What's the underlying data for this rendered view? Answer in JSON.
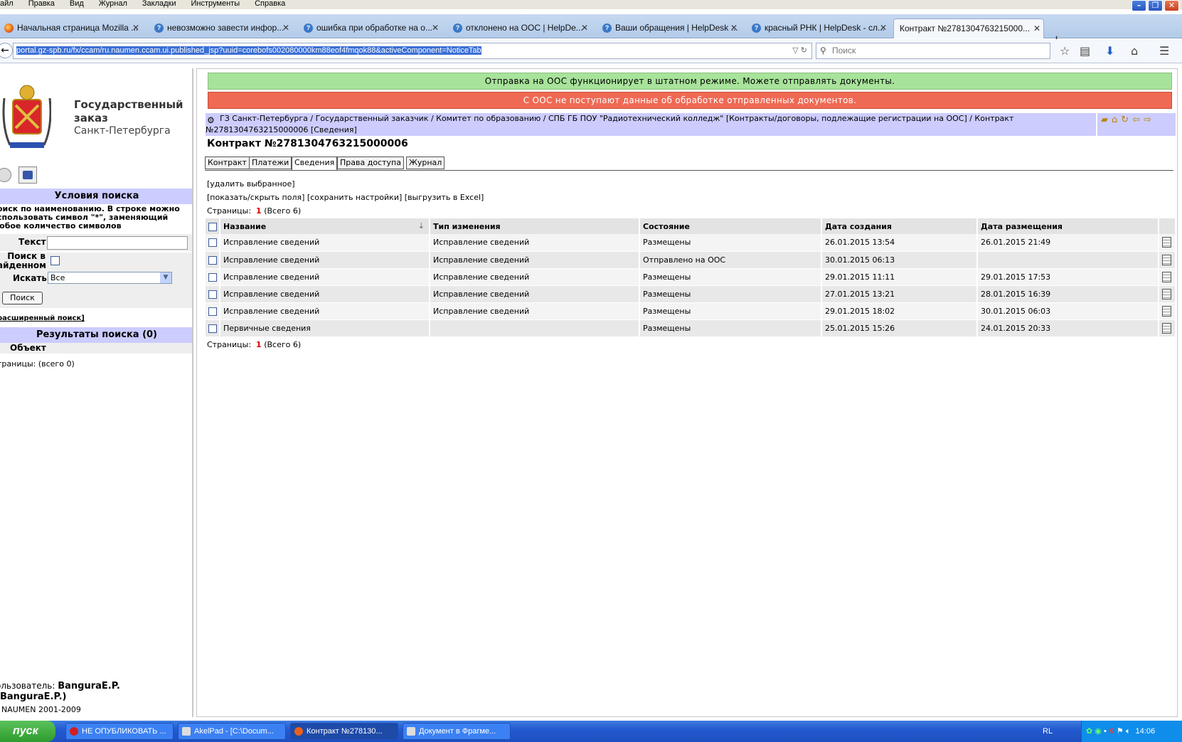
{
  "menubar": [
    "айл",
    "Правка",
    "Вид",
    "Журнал",
    "Закладки",
    "Инструменты",
    "Справка"
  ],
  "browser_tabs": [
    {
      "label": "Начальная страница Mozilla ...",
      "icon": "firefox-icon"
    },
    {
      "label": "невозможно завести инфор...",
      "icon": "help-icon"
    },
    {
      "label": "ошибка при обработке на о...",
      "icon": "help-icon"
    },
    {
      "label": "отклонено на ООС | HelpDe...",
      "icon": "help-icon"
    },
    {
      "label": "Ваши обращения | HelpDesk ...",
      "icon": "help-icon"
    },
    {
      "label": "красный РНК | HelpDesk - сл...",
      "icon": "help-icon"
    },
    {
      "label": "Контракт №2781304763215000...",
      "icon": "none"
    }
  ],
  "address": {
    "url": "portal.gz-spb.ru/fx/ccam/ru.naumen.ccam.ui.published_jsp?uuid=corebofs002080000km88eof4fmqok88&activeComponent=NoticeTab"
  },
  "browser_search": {
    "placeholder": "Поиск"
  },
  "org": {
    "title_line1": "Государственный",
    "title_line2": "заказ",
    "city": "Санкт-Петербурга"
  },
  "search_panel": {
    "header": "Условия поиска",
    "hint_line1": "оиск по наименованию. В строке можно",
    "hint_line2": "спользовать символ \"*\", заменяющий",
    "hint_line3": "юбое количество символов",
    "text_label": "Текст",
    "text_value": "",
    "found_label_1": "Поиск в",
    "found_label_2": "айденном",
    "search_in_label": "Искать",
    "search_in_value": "Все",
    "button": "Поиск",
    "advanced": "расширенный поиск]"
  },
  "results": {
    "header": "Результаты поиска (0)",
    "column": "Объект",
    "pages": "траницы:  (всего 0)"
  },
  "user": {
    "prefix": "ользователь:",
    "name": "BanguraE.P. (BanguraE.P.)"
  },
  "copyright": "NAUMEN 2001-2009",
  "status": {
    "ok": "Отправка на ООС функционирует в штатном режиме. Можете отправлять документы.",
    "error": "С ООС не поступают данные об обработке отправленных документов.",
    "colors": {
      "ok": "#a8e39b",
      "error": "#ef6a55"
    }
  },
  "breadcrumb": {
    "line1": "ГЗ Санкт-Петербурга / Государственный заказчик / Комитет по образованию / СПБ ГБ ПОУ \"Радиотехнический колледж\" [Контракты/договоры, подлежащие регистрации на ООС] / Контракт",
    "line2": "№2781304763215000006 [Сведения]"
  },
  "page_title": "Контракт №2781304763215000006",
  "content_tabs": [
    "Контракт",
    "Платежи",
    "Сведения",
    "Права доступа",
    "Журнал"
  ],
  "active_tab": "Сведения",
  "actions": {
    "delete": "[удалить выбранное]",
    "toggle_fields": "[показать/скрыть поля]",
    "save_settings": "[сохранить настройки]",
    "export_excel": "[выгрузить в Excel]"
  },
  "pager": {
    "label": "Страницы:",
    "current": "1",
    "total": "(Всего 6)"
  },
  "table": {
    "columns": [
      "Название",
      "Тип изменения",
      "Состояние",
      "Дата создания",
      "Дата размещения"
    ],
    "rows": [
      [
        "Исправление сведений",
        "Исправление сведений",
        "Размещены",
        "26.01.2015 13:54",
        "26.01.2015 21:49"
      ],
      [
        "Исправление сведений",
        "Исправление сведений",
        "Отправлено на ООС",
        "30.01.2015 06:13",
        ""
      ],
      [
        "Исправление сведений",
        "Исправление сведений",
        "Размещены",
        "29.01.2015 11:11",
        "29.01.2015 17:53"
      ],
      [
        "Исправление сведений",
        "Исправление сведений",
        "Размещены",
        "27.01.2015 13:21",
        "28.01.2015 16:39"
      ],
      [
        "Исправление сведений",
        "Исправление сведений",
        "Размещены",
        "29.01.2015 18:02",
        "30.01.2015 06:03"
      ],
      [
        "Первичные сведения",
        "",
        "Размещены",
        "25.01.2015 15:26",
        "24.01.2015 20:33"
      ]
    ]
  },
  "taskbar": {
    "start": "пуск",
    "tasks": [
      "НЕ ОПУБЛИКОВАТЬ ...",
      "AkelPad - [C:\\Docum...",
      "Контракт №278130...",
      "Документ в Фрагме..."
    ],
    "lang": "RL",
    "clock": "14:06"
  }
}
